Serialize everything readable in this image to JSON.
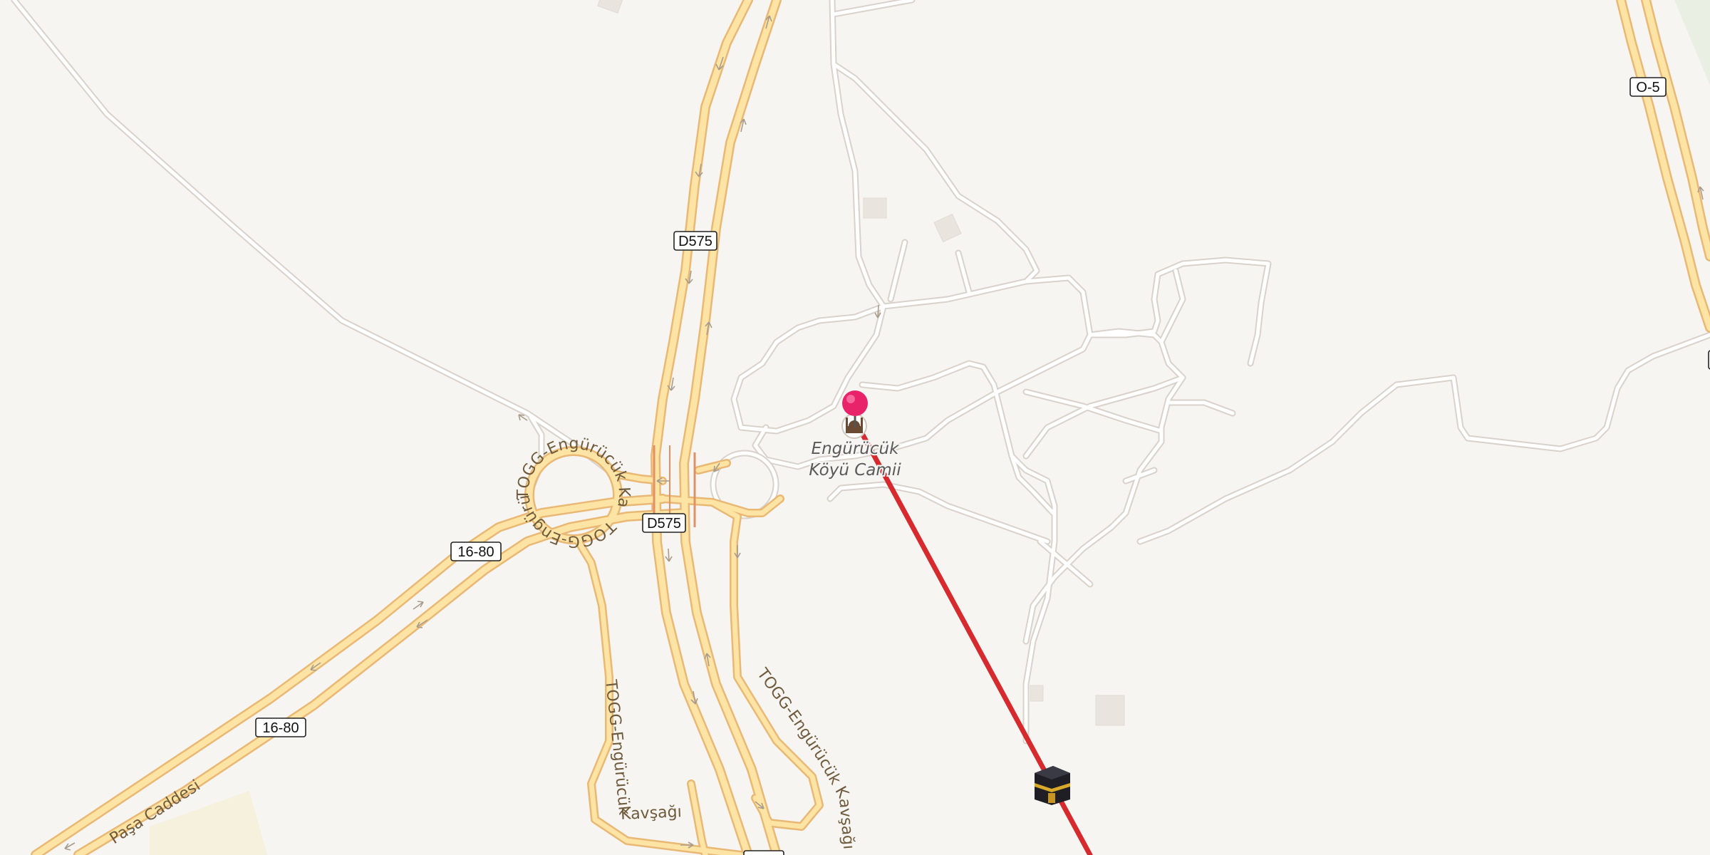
{
  "map": {
    "shields": [
      {
        "id": "d575-north",
        "ref": "D575"
      },
      {
        "id": "d575-south",
        "ref": "D575"
      },
      {
        "id": "1680-west",
        "ref": "16-80"
      },
      {
        "id": "1680-southwest",
        "ref": "16-80"
      },
      {
        "id": "o5",
        "ref": "O-5"
      }
    ],
    "street_labels": {
      "togg_kavsagi_ring": "TOGG-Engürücük Kavşağı",
      "togg_kavsagi_south": "TOGG-Engürücük Kavşağı",
      "togg_kavsagi_east": "TOGG-Engürücük Kavşağı",
      "pasa_caddesi": "Paşa Caddesi"
    },
    "poi": {
      "mosque_name_line1": "Engürücük",
      "mosque_name_line2": "Köyü Camii",
      "mosque_icon": "mosque-icon",
      "kaaba_icon": "kaaba-icon",
      "pin_icon": "location-pin-icon"
    },
    "colors": {
      "background": "#f7f5f2",
      "minor_road": "#ffffff",
      "highway": "#fde4a4",
      "route_line": "#d62a2f",
      "pin": "#e8236a"
    }
  }
}
